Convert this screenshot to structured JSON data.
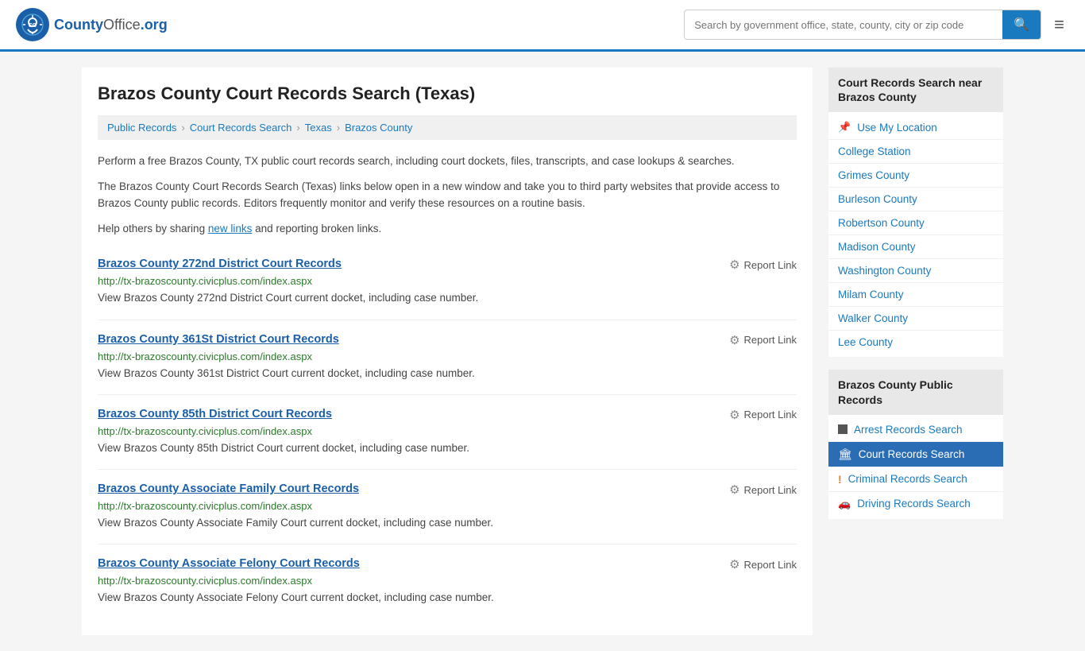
{
  "header": {
    "logo_text": "County",
    "logo_suffix": "Office.org",
    "search_placeholder": "Search by government office, state, county, city or zip code",
    "menu_icon": "≡"
  },
  "page": {
    "title": "Brazos County Court Records Search (Texas)",
    "breadcrumbs": [
      {
        "label": "Public Records",
        "href": "#"
      },
      {
        "label": "Court Records Search",
        "href": "#"
      },
      {
        "label": "Texas",
        "href": "#"
      },
      {
        "label": "Brazos County",
        "href": "#"
      }
    ],
    "description1": "Perform a free Brazos County, TX public court records search, including court dockets, files, transcripts, and case lookups & searches.",
    "description2": "The Brazos County Court Records Search (Texas) links below open in a new window and take you to third party websites that provide access to Brazos County public records. Editors frequently monitor and verify these resources on a routine basis.",
    "description3_before": "Help others by sharing ",
    "description3_link": "new links",
    "description3_after": " and reporting broken links."
  },
  "records": [
    {
      "title": "Brazos County 272nd District Court Records",
      "url": "http://tx-brazoscounty.civicplus.com/index.aspx",
      "desc": "View Brazos County 272nd District Court current docket, including case number.",
      "report": "Report Link"
    },
    {
      "title": "Brazos County 361St District Court Records",
      "url": "http://tx-brazoscounty.civicplus.com/index.aspx",
      "desc": "View Brazos County 361st District Court current docket, including case number.",
      "report": "Report Link"
    },
    {
      "title": "Brazos County 85th District Court Records",
      "url": "http://tx-brazoscounty.civicplus.com/index.aspx",
      "desc": "View Brazos County 85th District Court current docket, including case number.",
      "report": "Report Link"
    },
    {
      "title": "Brazos County Associate Family Court Records",
      "url": "http://tx-brazoscounty.civicplus.com/index.aspx",
      "desc": "View Brazos County Associate Family Court current docket, including case number.",
      "report": "Report Link"
    },
    {
      "title": "Brazos County Associate Felony Court Records",
      "url": "http://tx-brazoscounty.civicplus.com/index.aspx",
      "desc": "View Brazos County Associate Felony Court current docket, including case number.",
      "report": "Report Link"
    }
  ],
  "sidebar": {
    "nearby_title": "Court Records Search near Brazos County",
    "nearby_links": [
      {
        "label": "Use My Location",
        "icon": "pin"
      },
      {
        "label": "College Station",
        "icon": "none"
      },
      {
        "label": "Grimes County",
        "icon": "none"
      },
      {
        "label": "Burleson County",
        "icon": "none"
      },
      {
        "label": "Robertson County",
        "icon": "none"
      },
      {
        "label": "Madison County",
        "icon": "none"
      },
      {
        "label": "Washington County",
        "icon": "none"
      },
      {
        "label": "Milam County",
        "icon": "none"
      },
      {
        "label": "Walker County",
        "icon": "none"
      },
      {
        "label": "Lee County",
        "icon": "none"
      }
    ],
    "public_records_title": "Brazos County Public Records",
    "public_records_links": [
      {
        "label": "Arrest Records Search",
        "icon": "square",
        "active": false
      },
      {
        "label": "Court Records Search",
        "icon": "building",
        "active": true
      },
      {
        "label": "Criminal Records Search",
        "icon": "exclaim",
        "active": false
      },
      {
        "label": "Driving Records Search",
        "icon": "car",
        "active": false
      }
    ]
  }
}
